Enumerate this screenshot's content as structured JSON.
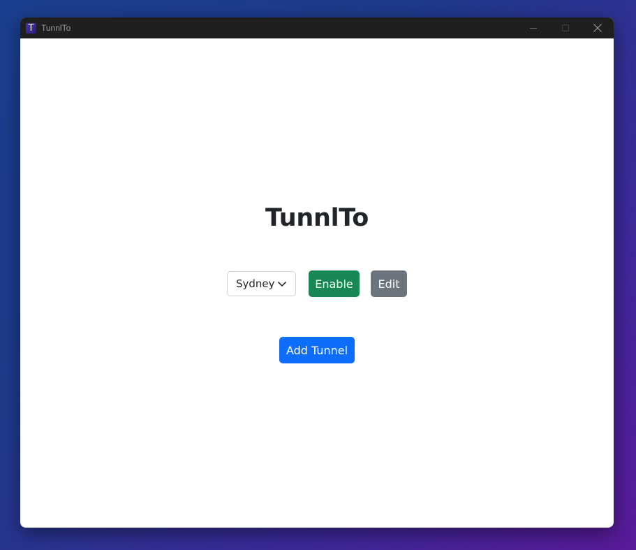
{
  "window": {
    "title": "TunnlTo",
    "icon_letter": "T",
    "icon": "tunnlto-app-icon",
    "controls": [
      "minimize-icon",
      "maximize-icon",
      "close-icon"
    ]
  },
  "main": {
    "heading": "TunnlTo",
    "tunnel_select": {
      "selected": "Sydney"
    },
    "enable_label": "Enable",
    "edit_label": "Edit",
    "add_tunnel_label": "Add Tunnel"
  },
  "colors": {
    "titlebar": "#1f1f1f",
    "enable": "#198754",
    "edit": "#6c757d",
    "add": "#0d6efd",
    "heading": "#212529"
  }
}
